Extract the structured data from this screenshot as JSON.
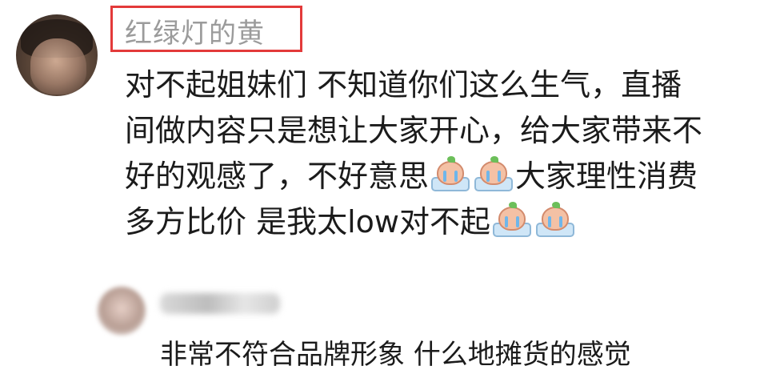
{
  "comment": {
    "username": "红绿灯的黄",
    "username_highlight_color": "#e33a3a",
    "lines": [
      [
        "对不起姐妹们 不知道你们这么生气，直播"
      ],
      [
        "间做内容只是想让大家开心，给大家带来不"
      ],
      [
        "好的观感了，不好意思",
        "大家理性消费"
      ],
      [
        "多方比价 是我太low对不起"
      ]
    ],
    "emoji_name": "crying-emoji"
  },
  "reply": {
    "text": "非常不符合品牌形象 什么地摊货的感觉"
  }
}
